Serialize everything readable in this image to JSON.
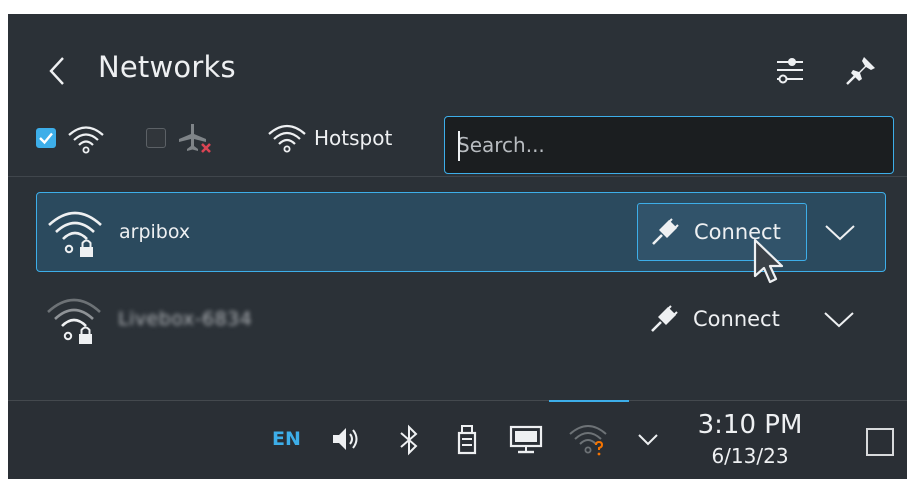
{
  "header": {
    "back_icon": "chevron-left-icon",
    "title": "Networks",
    "config_icon": "configure-sliders-icon",
    "pin_icon": "pin-icon"
  },
  "filters": {
    "wifi_checkbox_checked": true,
    "wifi_icon": "wifi-icon",
    "airplane_checkbox_checked": false,
    "airplane_icon": "airplane-disabled-icon",
    "hotspot_icon": "wifi-icon",
    "hotspot_label": "Hotspot",
    "search_value": "",
    "search_placeholder": "Search..."
  },
  "networks": [
    {
      "name": "arpibox",
      "icon": "wifi-locked-icon",
      "connect_label": "Connect",
      "connect_icon": "plug-icon",
      "expand_icon": "chevron-down-icon",
      "highlighted": true
    },
    {
      "name": "Livebox-6834",
      "icon": "wifi-locked-icon",
      "connect_label": "Connect",
      "connect_icon": "plug-icon",
      "expand_icon": "chevron-down-icon",
      "highlighted": false
    }
  ],
  "taskbar": {
    "keyboard_layout": "EN",
    "tray_icons": [
      "volume-icon",
      "bluetooth-icon",
      "usb-drive-icon",
      "display-icon",
      "network-unknown-icon",
      "chevron-down-icon"
    ],
    "time": "3:10 PM",
    "date": "6/13/23",
    "show_desktop_icon": "show-desktop-icon"
  },
  "colors": {
    "accent": "#3daee9",
    "background": "#2b3137",
    "highlight": "#2b4a5e",
    "error": "#da4453"
  }
}
